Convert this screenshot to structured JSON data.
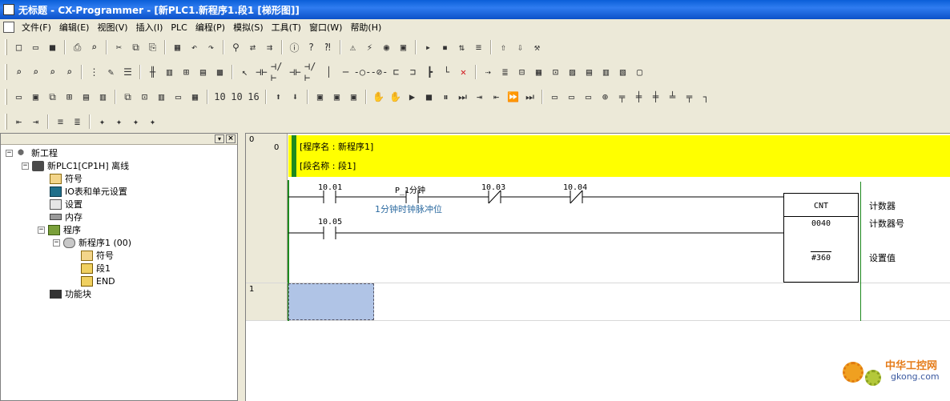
{
  "window": {
    "title": "无标题 - CX-Programmer - [新PLC1.新程序1.段1 [梯形图]]"
  },
  "menu": [
    "文件(F)",
    "编辑(E)",
    "视图(V)",
    "插入(I)",
    "PLC",
    "编程(P)",
    "模拟(S)",
    "工具(T)",
    "窗口(W)",
    "帮助(H)"
  ],
  "toolbar1": [
    {
      "icon": "new-icon",
      "glyph": "□"
    },
    {
      "icon": "open-icon",
      "glyph": "▭"
    },
    {
      "icon": "save-icon",
      "glyph": "■"
    },
    {
      "icon": "print-icon",
      "glyph": "⎙"
    },
    {
      "icon": "print-preview-icon",
      "glyph": "⌕"
    },
    {
      "icon": "cut-icon",
      "glyph": "✂"
    },
    {
      "icon": "copy-icon",
      "glyph": "⧉"
    },
    {
      "icon": "paste-icon",
      "glyph": "⎘"
    },
    {
      "icon": "compile-icon",
      "glyph": "▦"
    },
    {
      "icon": "undo-icon",
      "glyph": "↶"
    },
    {
      "icon": "redo-icon",
      "glyph": "↷"
    },
    {
      "icon": "find-icon",
      "glyph": "⚲"
    },
    {
      "icon": "replace-icon",
      "glyph": "⇄"
    },
    {
      "icon": "cross-ref-icon",
      "glyph": "⇉"
    },
    {
      "icon": "info-icon",
      "glyph": "ⓘ"
    },
    {
      "icon": "help-icon",
      "glyph": "?"
    },
    {
      "icon": "context-help-icon",
      "glyph": "⁈"
    },
    {
      "icon": "warning-icon",
      "glyph": "⚠"
    },
    {
      "icon": "online-icon",
      "glyph": "⚡"
    },
    {
      "icon": "monitor-icon",
      "glyph": "◉"
    },
    {
      "icon": "plc-mode-icon",
      "glyph": "▣"
    },
    {
      "icon": "run-icon",
      "glyph": "▸"
    },
    {
      "icon": "stop-icon",
      "glyph": "▪"
    },
    {
      "icon": "transfer-icon",
      "glyph": "⇅"
    },
    {
      "icon": "compare-icon",
      "glyph": "≡"
    },
    {
      "icon": "upload-icon",
      "glyph": "⇧"
    },
    {
      "icon": "download-icon",
      "glyph": "⇩"
    },
    {
      "icon": "tool-icon",
      "glyph": "⚒"
    }
  ],
  "toolbar2": [
    {
      "icon": "zoom-in-icon",
      "glyph": "⌕"
    },
    {
      "icon": "zoom-icon",
      "glyph": "⌕"
    },
    {
      "icon": "zoom-out-icon",
      "glyph": "⌕"
    },
    {
      "icon": "zoom-fit-icon",
      "glyph": "⌕"
    },
    {
      "icon": "grid-icon",
      "glyph": "⋮"
    },
    {
      "icon": "comment-icon",
      "glyph": "✎"
    },
    {
      "icon": "list-icon",
      "glyph": "☰"
    },
    {
      "icon": "ladder-view-icon",
      "glyph": "╫"
    },
    {
      "icon": "block-icon",
      "glyph": "▥"
    },
    {
      "icon": "tree-icon",
      "glyph": "⊞"
    },
    {
      "icon": "mnemonic-icon",
      "glyph": "▤"
    },
    {
      "icon": "cxt-icon",
      "glyph": "▩"
    },
    {
      "icon": "select-icon",
      "glyph": "↖"
    },
    {
      "icon": "no-contact-icon",
      "glyph": "⊣⊢"
    },
    {
      "icon": "nc-contact-icon",
      "glyph": "⊣/⊢"
    },
    {
      "icon": "or-no-icon",
      "glyph": "⊣⊢"
    },
    {
      "icon": "or-nc-icon",
      "glyph": "⊣/⊢"
    },
    {
      "icon": "vertical-icon",
      "glyph": "│"
    },
    {
      "icon": "horizontal-icon",
      "glyph": "─"
    },
    {
      "icon": "coil-icon",
      "glyph": "-○-"
    },
    {
      "icon": "nc-coil-icon",
      "glyph": "-⊘-"
    },
    {
      "icon": "pdu-icon",
      "glyph": "⊏"
    },
    {
      "icon": "instr-icon",
      "glyph": "⊐"
    },
    {
      "icon": "bit-icon",
      "glyph": "┣"
    },
    {
      "icon": "line-icon",
      "glyph": "└"
    },
    {
      "icon": "delete-icon",
      "glyph": "✕"
    },
    {
      "icon": "find-next-icon",
      "glyph": "⇢"
    },
    {
      "icon": "prop-icon",
      "glyph": "≣"
    },
    {
      "icon": "io-icon",
      "glyph": "⊟"
    },
    {
      "icon": "addr-icon",
      "glyph": "▦"
    },
    {
      "icon": "chg-icon",
      "glyph": "⊡"
    },
    {
      "icon": "mem-icon",
      "glyph": "▨"
    },
    {
      "icon": "watch-icon",
      "glyph": "▤"
    },
    {
      "icon": "trace-icon",
      "glyph": "▥"
    },
    {
      "icon": "diff-icon",
      "glyph": "▧"
    },
    {
      "icon": "check-icon",
      "glyph": "▢"
    }
  ],
  "toolbar3": [
    {
      "icon": "window-icon",
      "glyph": "▭"
    },
    {
      "icon": "tile-icon",
      "glyph": "▣"
    },
    {
      "icon": "cascade-icon",
      "glyph": "⧉"
    },
    {
      "icon": "arrange-icon",
      "glyph": "⊞"
    },
    {
      "icon": "output-icon",
      "glyph": "▤"
    },
    {
      "icon": "monitor-win-icon",
      "glyph": "▥"
    },
    {
      "icon": "sym-icon",
      "glyph": "⧉"
    },
    {
      "icon": "chart-icon",
      "glyph": "⊡"
    },
    {
      "icon": "ladder-icon",
      "glyph": "▥"
    },
    {
      "icon": "panel-icon",
      "glyph": "▭"
    },
    {
      "icon": "memory-icon",
      "glyph": "▦"
    },
    {
      "icon": "num10-icon",
      "glyph": "10"
    },
    {
      "icon": "num10b-icon",
      "glyph": "10"
    },
    {
      "icon": "num16-icon",
      "glyph": "16"
    },
    {
      "icon": "up-icon",
      "glyph": "⬆"
    },
    {
      "icon": "down-icon",
      "glyph": "⬇"
    },
    {
      "icon": "sim-icon",
      "glyph": "▣"
    },
    {
      "icon": "sim2-icon",
      "glyph": "▣"
    },
    {
      "icon": "sim3-icon",
      "glyph": "▣"
    },
    {
      "icon": "hand-icon",
      "glyph": "✋"
    },
    {
      "icon": "hand2-icon",
      "glyph": "✋"
    },
    {
      "icon": "play-icon",
      "glyph": "▶"
    },
    {
      "icon": "stop-sim-icon",
      "glyph": "■"
    },
    {
      "icon": "pause-icon",
      "glyph": "⏸"
    },
    {
      "icon": "step-icon",
      "glyph": "⏭"
    },
    {
      "icon": "step-in-icon",
      "glyph": "⇥"
    },
    {
      "icon": "step-out-icon",
      "glyph": "⇤"
    },
    {
      "icon": "ff-icon",
      "glyph": "⏩"
    },
    {
      "icon": "end-icon",
      "glyph": "⏭"
    },
    {
      "icon": "sfc1-icon",
      "glyph": "▭"
    },
    {
      "icon": "sfc2-icon",
      "glyph": "▭"
    },
    {
      "icon": "sfc3-icon",
      "glyph": "▭"
    },
    {
      "icon": "sfc4-icon",
      "glyph": "⊕"
    },
    {
      "icon": "sfc5-icon",
      "glyph": "╤"
    },
    {
      "icon": "sfc6-icon",
      "glyph": "╪"
    },
    {
      "icon": "sfc7-icon",
      "glyph": "╪"
    },
    {
      "icon": "sfc8-icon",
      "glyph": "╧"
    },
    {
      "icon": "sfc9-icon",
      "glyph": "╤"
    },
    {
      "icon": "sfc10-icon",
      "glyph": "┐"
    }
  ],
  "toolbar4": [
    {
      "icon": "indent-icon",
      "glyph": "⇤"
    },
    {
      "icon": "outdent-icon",
      "glyph": "⇥"
    },
    {
      "icon": "align-icon",
      "glyph": "≡"
    },
    {
      "icon": "align2-icon",
      "glyph": "≣"
    },
    {
      "icon": "bp-icon",
      "glyph": "✦"
    },
    {
      "icon": "bp2-icon",
      "glyph": "✦"
    },
    {
      "icon": "bp3-icon",
      "glyph": "✦"
    },
    {
      "icon": "bp4-icon",
      "glyph": "✦"
    }
  ],
  "tree": {
    "project": "新工程",
    "plc": "新PLC1[CP1H] 离线",
    "symbols": "符号",
    "io_table": "IO表和单元设置",
    "settings": "设置",
    "memory": "内存",
    "programs": "程序",
    "task": "新程序1 (00)",
    "task_symbols": "符号",
    "section": "段1",
    "end": "END",
    "function_blocks": "功能块"
  },
  "ladder": {
    "rung0_num_a": "0",
    "rung0_num_b": "0",
    "rung1_num": "1",
    "program_name": "[程序名 : 新程序1]",
    "section_name": "[段名称 : 段1]",
    "contact1": "10.01",
    "contact2": "P_1分钟",
    "contact2_comment": "1分钟时钟脉冲位",
    "contact3": "10.03",
    "contact4": "10.04",
    "contact5": "10.05",
    "instr_name": "CNT",
    "instr_op1": "0040",
    "instr_op2": "#360",
    "desc_instr": "计数器",
    "desc_op1": "计数器号",
    "desc_op2": "设置值"
  },
  "watermark": {
    "brand": "中华工控网",
    "url": "gkong.com"
  }
}
